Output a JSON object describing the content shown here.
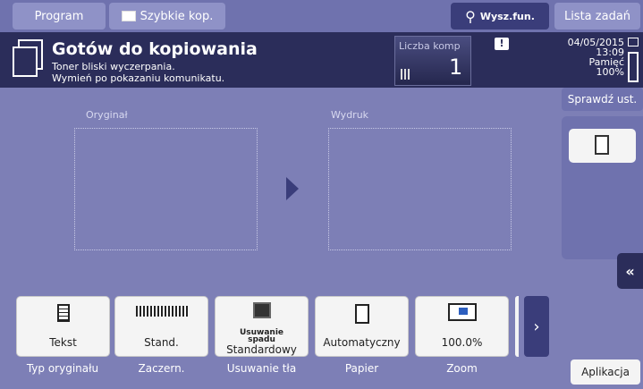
{
  "topbar": {
    "program_label": "Program",
    "quick_copy_label": "Szybkie kop.",
    "search_label": "Wysz.fun.",
    "job_list_label": "Lista zadań"
  },
  "status": {
    "title": "Gotów do kopiowania",
    "line1": "Toner bliski wyczerpania.",
    "line2": "Wymień po pokazaniu komunikatu.",
    "copies_label": "Liczba komp",
    "copies_value": "1",
    "date": "04/05/2015",
    "time": "13:09",
    "memory_label": "Pamięć",
    "memory_value": "100%"
  },
  "main": {
    "original_label": "Oryginał",
    "output_label": "Wydruk"
  },
  "right": {
    "check_settings_label": "Sprawdź ust."
  },
  "functions": [
    {
      "value": "Tekst",
      "caption": "Typ oryginału"
    },
    {
      "value": "Stand.",
      "caption": "Zaczern."
    },
    {
      "value_line1": "Usuwanie",
      "value_line2": "spadu",
      "value_line3": "Standardowy",
      "caption": "Usuwanie tła"
    },
    {
      "value": "Automatyczny",
      "caption": "Papier"
    },
    {
      "value": "100.0%",
      "caption": "Zoom"
    }
  ],
  "apps_label": "Aplikacja",
  "colors": {
    "background": "#7d7fb6",
    "topbar": "#6f72ae",
    "statusbar": "#2b2d5a",
    "button": "#f4f4f4"
  }
}
